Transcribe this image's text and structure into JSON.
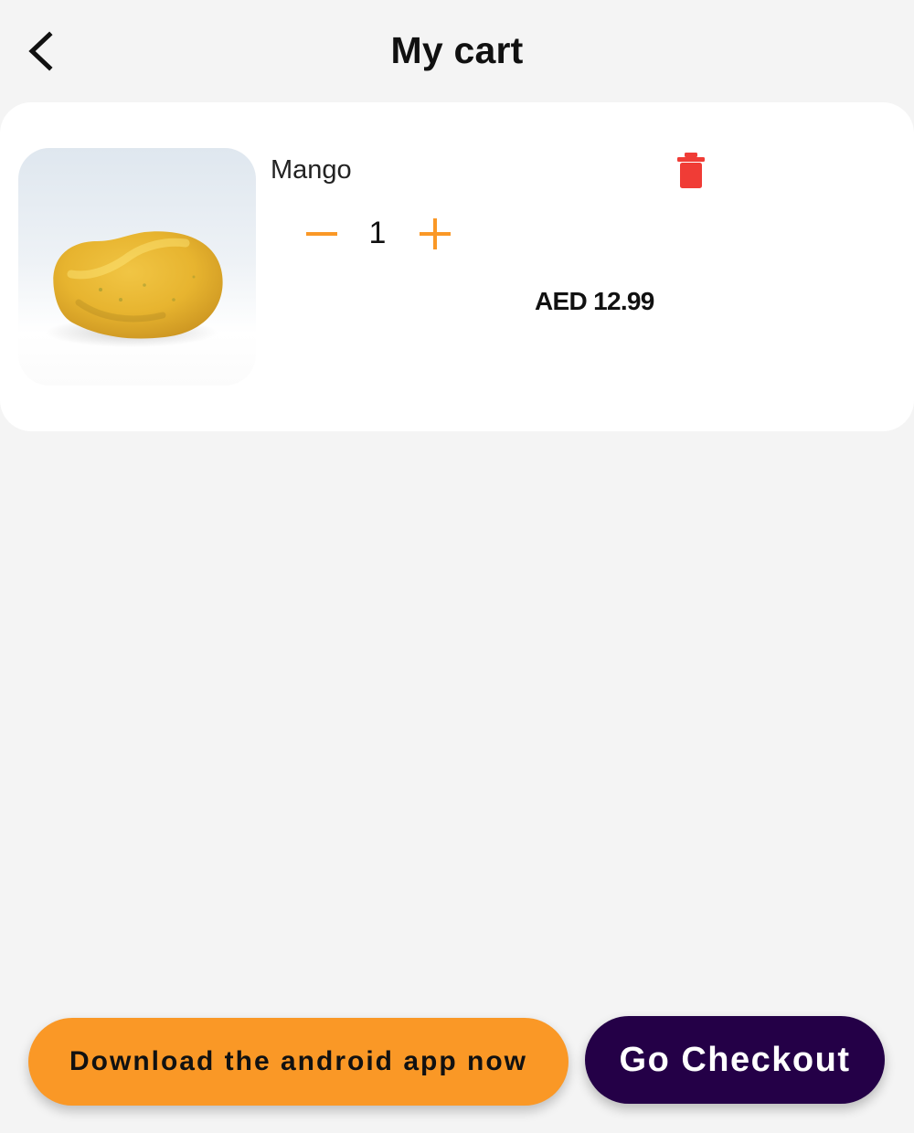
{
  "header": {
    "title": "My cart",
    "back_icon": "chevron-left-icon"
  },
  "cart": {
    "items": [
      {
        "name": "Mango",
        "quantity": "1",
        "price": "AED 12.99",
        "delete_icon": "trash-icon",
        "decrease_icon": "minus-icon",
        "increase_icon": "plus-icon",
        "image_description": "mango-image"
      }
    ]
  },
  "actions": {
    "download_label": "Download the android app now",
    "checkout_label": "Go Checkout"
  },
  "colors": {
    "background": "#f4f4f4",
    "card": "#ffffff",
    "accent_orange": "#fa9826",
    "checkout_purple": "#240047",
    "delete_red": "#f03c36"
  }
}
